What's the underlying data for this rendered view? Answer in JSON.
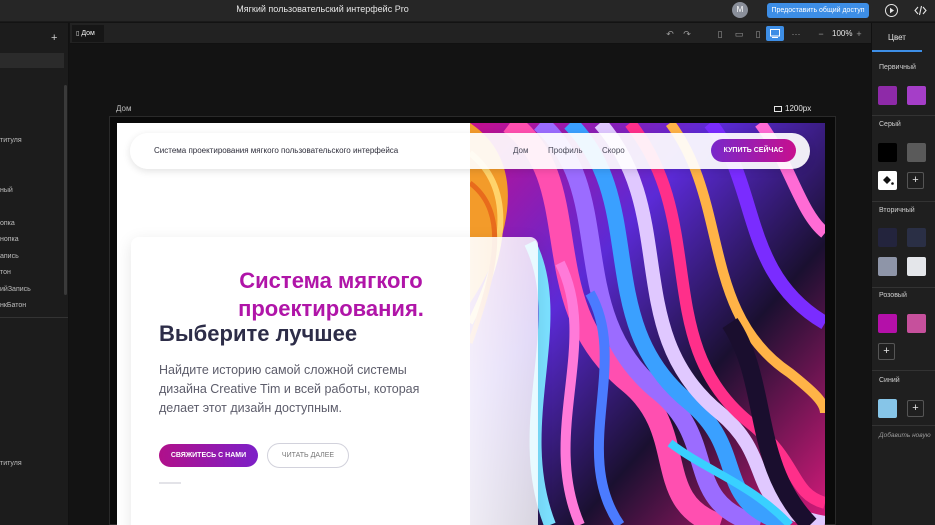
{
  "app": {
    "title": "Мягкий пользовательский интерфейс Pro",
    "avatar_initial": "M",
    "share_label": "Предоставить общий доступ"
  },
  "left_panel": {
    "layers": [
      {
        "label": "титуля"
      },
      {
        "label": "ный"
      },
      {
        "label": "опка"
      },
      {
        "label": "нопка"
      },
      {
        "label": "апись"
      },
      {
        "label": "тон"
      },
      {
        "label": "ийЗапись"
      },
      {
        "label": "нкБатон"
      },
      {
        "label": "титуля"
      }
    ]
  },
  "tabs": {
    "active_doc": "Дом",
    "zoom": "100%"
  },
  "canvas": {
    "frame_label": "Дом",
    "frame_size": "1200px"
  },
  "site": {
    "brand": "Система проектирования мягкого пользовательского интерфейса",
    "nav": [
      "Дом",
      "Профиль",
      "Скоро"
    ],
    "buy_label": "КУПИТЬ СЕЙЧАС",
    "title_accent_line1": "Система мягкого",
    "title_accent_line2": "проектирования.",
    "title_dark": "Выберите лучшее",
    "lead": "Найдите историю самой сложной системы дизайна Creative Tim и всей работы, которая делает этот дизайн доступным.",
    "contact_label": "СВЯЖИТЕСЬ С НАМИ",
    "read_label": "ЧИТАТЬ ДАЛЕЕ"
  },
  "right_panel": {
    "tab": "Цвет",
    "sections": {
      "primary": "Первичный",
      "gray": "Серый",
      "secondary": "Вторичный",
      "pink": "Розовый",
      "blue": "Синий"
    },
    "add_note": "Добавить новую",
    "colors": {
      "primary_1": "#8e2aa8",
      "primary_2": "#a53ec8",
      "gray_1": "#000000",
      "gray_2": "#5a5a5a",
      "secondary_1": "#23243d",
      "secondary_2": "#2a2f45",
      "secondary_3": "#8e95a8",
      "secondary_4": "#e4e6ea",
      "pink_1": "#b410a9",
      "pink_2": "#c6509c",
      "blue_1": "#86c5e8"
    }
  }
}
